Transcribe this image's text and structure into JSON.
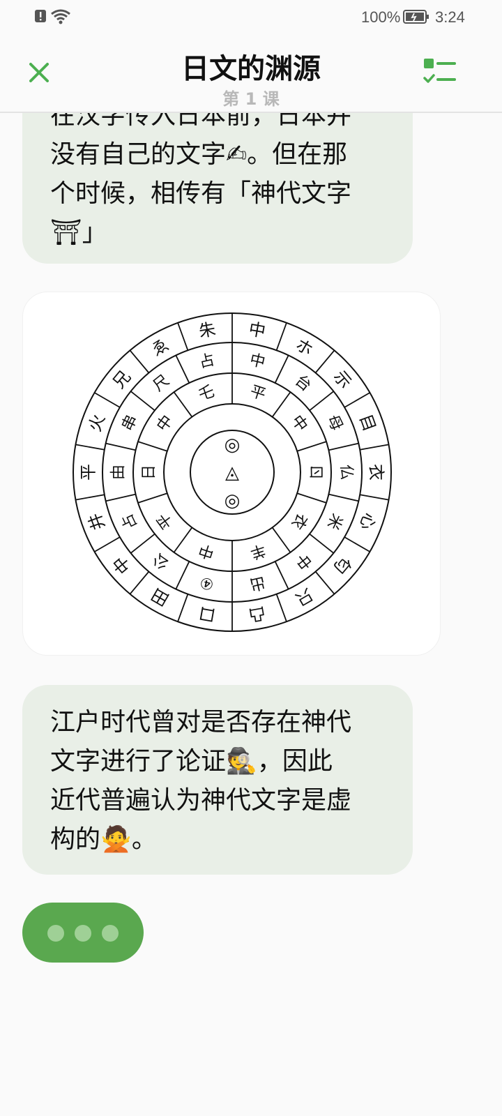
{
  "status_bar": {
    "battery_pct": "100%",
    "time": "3:24"
  },
  "header": {
    "title": "日文的渊源",
    "subtitle": "第 1 课"
  },
  "messages": [
    {
      "lines": [
        "在汉字传入日本前，日本并",
        "没有自己的文字✍。但在那",
        "个时候，相传有「神代文字",
        "⛩」"
      ]
    },
    {
      "lines": [
        "江户时代曾对是否存在神代",
        "文字进行了论证🕵，因此",
        "近代普遍认为神代文字是虚",
        "构的🙅。"
      ]
    }
  ],
  "image": {
    "subject": "kamiyo-moji-circular-chart",
    "ring_chars": {
      "outer": [
        "中",
        "ホ",
        "示",
        "目",
        "衣",
        "心",
        "匂",
        "只",
        "凸",
        "口",
        "田",
        "中",
        "井",
        "平",
        "火",
        "兄",
        "ゑ",
        "朱"
      ],
      "middle": [
        "中",
        "台",
        "母",
        "仏",
        "米",
        "中",
        "出",
        "④",
        "公",
        "占",
        "由",
        "串",
        "尺",
        "占"
      ],
      "inner": [
        "平",
        "中",
        "ㄖ",
        "衣",
        "羊",
        "中",
        "平",
        "日",
        "中",
        "乇"
      ],
      "center": [
        "◎",
        "◬",
        "◎"
      ]
    }
  },
  "colors": {
    "accent": "#4caf50",
    "bubble_bg": "#e9efe7",
    "typing_bg": "#5aa84f"
  },
  "icons": {
    "close": "close-icon",
    "menu": "checklist-icon"
  }
}
